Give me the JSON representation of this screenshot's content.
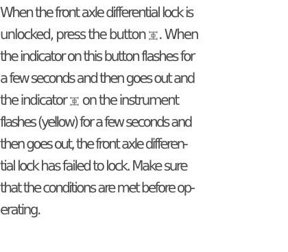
{
  "paragraph": {
    "lines": [
      "When the front axle differential lock is",
      "unlocked, press the button ",
      ". When",
      "the indicator on this button flashes for",
      "a few seconds and then goes out and",
      "the indicator ",
      " on the instrument",
      "flashes (yellow) for a few seconds and",
      "then goes out, the front axle differen-",
      "tial lock has failed to lock. Make sure",
      "that the conditions are met before op-",
      "erating."
    ]
  },
  "icons": {
    "button_icon": "front-axle-diff-lock-icon",
    "instrument_icon": "front-axle-diff-lock-indicator-icon"
  }
}
